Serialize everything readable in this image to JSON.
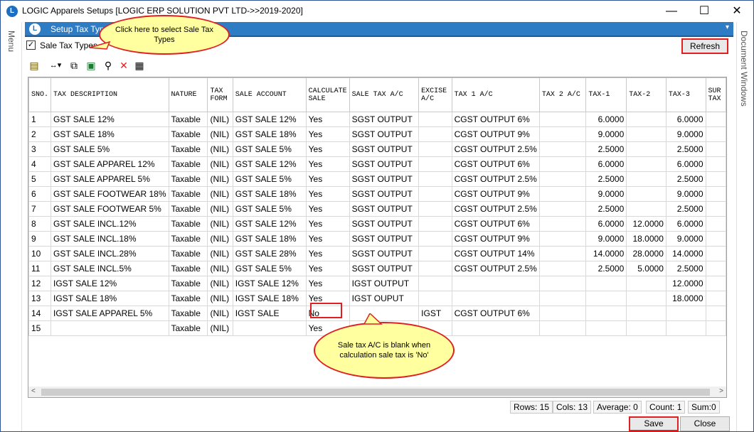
{
  "window": {
    "title": "LOGIC Apparels Setups  [LOGIC ERP SOLUTION PVT LTD->>2019-2020]",
    "app_icon": "logic-logo-icon",
    "minimize": "—",
    "maximize": "☐",
    "close": "✕"
  },
  "side": {
    "menu_label": "Menu",
    "document_windows_label": "Document Windows"
  },
  "tab": {
    "title": "Setup Tax Types",
    "dropdown_icon": "▾"
  },
  "filter": {
    "checkbox_label": "Sale Tax Types",
    "checked": true,
    "check_mark": "✓"
  },
  "buttons": {
    "refresh": "Refresh",
    "save": "Save",
    "close": "Close"
  },
  "toolbar": {
    "icons": [
      "edit-icon",
      "column-width-icon",
      "copy-icon",
      "excel-export-icon",
      "find-icon",
      "delete-icon",
      "grid-icon"
    ]
  },
  "grid": {
    "columns": [
      "SNO.",
      "TAX DESCRIPTION",
      "NATURE",
      "TAX FORM",
      "SALE ACCOUNT",
      "CALCULATE SALE",
      "SALE TAX A/C",
      "EXCISE A/C",
      "TAX 1 A/C",
      "TAX 2 A/C",
      "TAX-1",
      "TAX-2",
      "TAX-3",
      "SUR TAX"
    ],
    "rows": [
      [
        "1",
        "GST SALE 12%",
        "Taxable",
        "(NIL)",
        "GST SALE 12%",
        "Yes",
        "SGST OUTPUT",
        "",
        "CGST OUTPUT 6%",
        "",
        "6.0000",
        "",
        "6.0000",
        ""
      ],
      [
        "2",
        "GST SALE 18%",
        "Taxable",
        "(NIL)",
        "GST SALE 18%",
        "Yes",
        "SGST OUTPUT",
        "",
        "CGST OUTPUT 9%",
        "",
        "9.0000",
        "",
        "9.0000",
        ""
      ],
      [
        "3",
        "GST SALE 5%",
        "Taxable",
        "(NIL)",
        "GST SALE 5%",
        "Yes",
        "SGST OUTPUT",
        "",
        "CGST OUTPUT 2.5%",
        "",
        "2.5000",
        "",
        "2.5000",
        ""
      ],
      [
        "4",
        "GST SALE APPAREL 12%",
        "Taxable",
        "(NIL)",
        "GST SALE 12%",
        "Yes",
        "SGST OUTPUT",
        "",
        "CGST OUTPUT 6%",
        "",
        "6.0000",
        "",
        "6.0000",
        ""
      ],
      [
        "5",
        "GST SALE APPAREL 5%",
        "Taxable",
        "(NIL)",
        "GST SALE 5%",
        "Yes",
        "SGST OUTPUT",
        "",
        "CGST OUTPUT 2.5%",
        "",
        "2.5000",
        "",
        "2.5000",
        ""
      ],
      [
        "6",
        "GST SALE FOOTWEAR 18%",
        "Taxable",
        "(NIL)",
        "GST SALE 18%",
        "Yes",
        "SGST OUTPUT",
        "",
        "CGST OUTPUT 9%",
        "",
        "9.0000",
        "",
        "9.0000",
        ""
      ],
      [
        "7",
        "GST SALE FOOTWEAR 5%",
        "Taxable",
        "(NIL)",
        "GST SALE 5%",
        "Yes",
        "SGST OUTPUT",
        "",
        "CGST OUTPUT 2.5%",
        "",
        "2.5000",
        "",
        "2.5000",
        ""
      ],
      [
        "8",
        "GST SALE INCL.12%",
        "Taxable",
        "(NIL)",
        "GST SALE 12%",
        "Yes",
        "SGST OUTPUT",
        "",
        "CGST OUTPUT 6%",
        "",
        "6.0000",
        "12.0000",
        "6.0000",
        ""
      ],
      [
        "9",
        "GST SALE INCL.18%",
        "Taxable",
        "(NIL)",
        "GST SALE 18%",
        "Yes",
        "SGST OUTPUT",
        "",
        "CGST OUTPUT 9%",
        "",
        "9.0000",
        "18.0000",
        "9.0000",
        ""
      ],
      [
        "10",
        "GST SALE INCL.28%",
        "Taxable",
        "(NIL)",
        "GST SALE 28%",
        "Yes",
        "SGST OUTPUT",
        "",
        "CGST OUTPUT 14%",
        "",
        "14.0000",
        "28.0000",
        "14.0000",
        ""
      ],
      [
        "11",
        "GST SALE INCL.5%",
        "Taxable",
        "(NIL)",
        "GST SALE 5%",
        "Yes",
        "SGST OUTPUT",
        "",
        "CGST OUTPUT 2.5%",
        "",
        "2.5000",
        "5.0000",
        "2.5000",
        ""
      ],
      [
        "12",
        "IGST SALE 12%",
        "Taxable",
        "(NIL)",
        "IGST SALE 12%",
        "Yes",
        "IGST OUTPUT",
        "",
        "",
        "",
        "",
        "",
        "12.0000",
        ""
      ],
      [
        "13",
        "IGST SALE 18%",
        "Taxable",
        "(NIL)",
        "IGST SALE 18%",
        "Yes",
        "IGST OUPUT",
        "",
        "",
        "",
        "",
        "",
        "18.0000",
        ""
      ],
      [
        "14",
        "IGST SALE APPAREL 5%",
        "Taxable",
        "(NIL)",
        "IGST SALE",
        "No",
        "",
        "IGST",
        "CGST OUTPUT 6%",
        "",
        "",
        "",
        "",
        ""
      ],
      [
        "15",
        "",
        "Taxable",
        "(NIL)",
        "",
        "Yes",
        "",
        "",
        "",
        "",
        "",
        "",
        "",
        ""
      ]
    ],
    "scroll_left": "<",
    "scroll_right": ">"
  },
  "status": {
    "rows": "Rows: 15",
    "cols": "Cols: 13",
    "average": "Average: 0",
    "count": "Count: 1",
    "sum": "Sum:0"
  },
  "callouts": {
    "select_tax_types": "Click here to select Sale Tax Types",
    "blank_account": "Sale tax A/C is blank when calculation sale tax is 'No'"
  },
  "colors": {
    "accent": "#2e7cc4",
    "highlight": "#e02020",
    "callout_fill": "#ffffa0"
  }
}
